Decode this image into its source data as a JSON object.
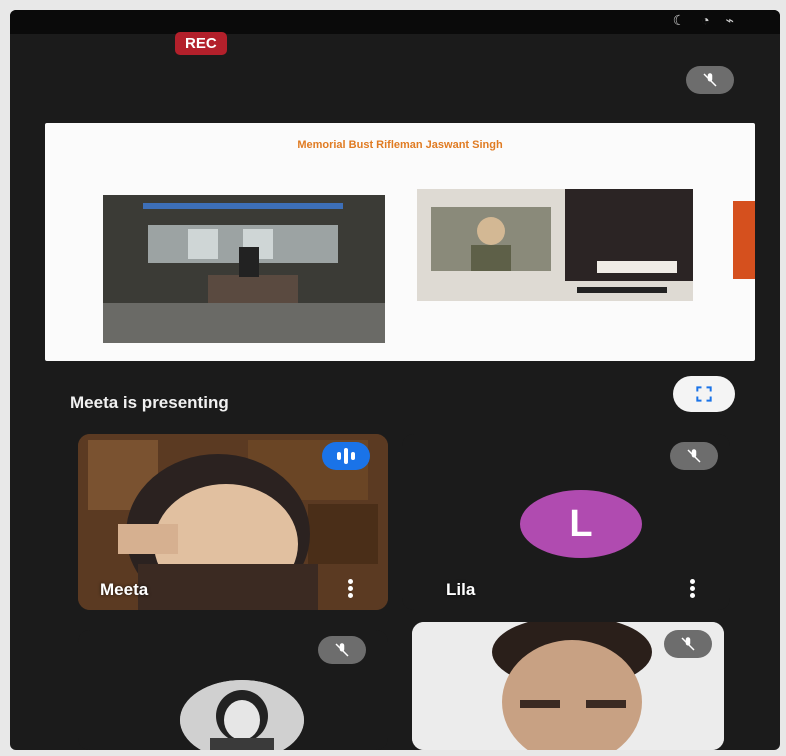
{
  "recording": {
    "label": "REC"
  },
  "presentation": {
    "slide_title": "Memorial Bust Rifleman Jaswant Singh"
  },
  "presenting": {
    "label": "Meeta is presenting"
  },
  "participants": [
    {
      "name": "Meeta",
      "state": "speaking"
    },
    {
      "name": "Lila",
      "avatar_letter": "L",
      "avatar_color": "#b04bb0",
      "state": "muted"
    },
    {
      "name": "",
      "state": "muted"
    },
    {
      "name": "",
      "state": "muted"
    }
  ],
  "colors": {
    "rec": "#b3202b",
    "speaking": "#1a73e8",
    "background": "#1b1b1b",
    "slide_title": "#e07b22"
  },
  "icons": {
    "mute": "mic-off-icon",
    "fullscreen": "fullscreen-icon",
    "more": "more-vert-icon",
    "speaking": "audio-level-icon"
  }
}
